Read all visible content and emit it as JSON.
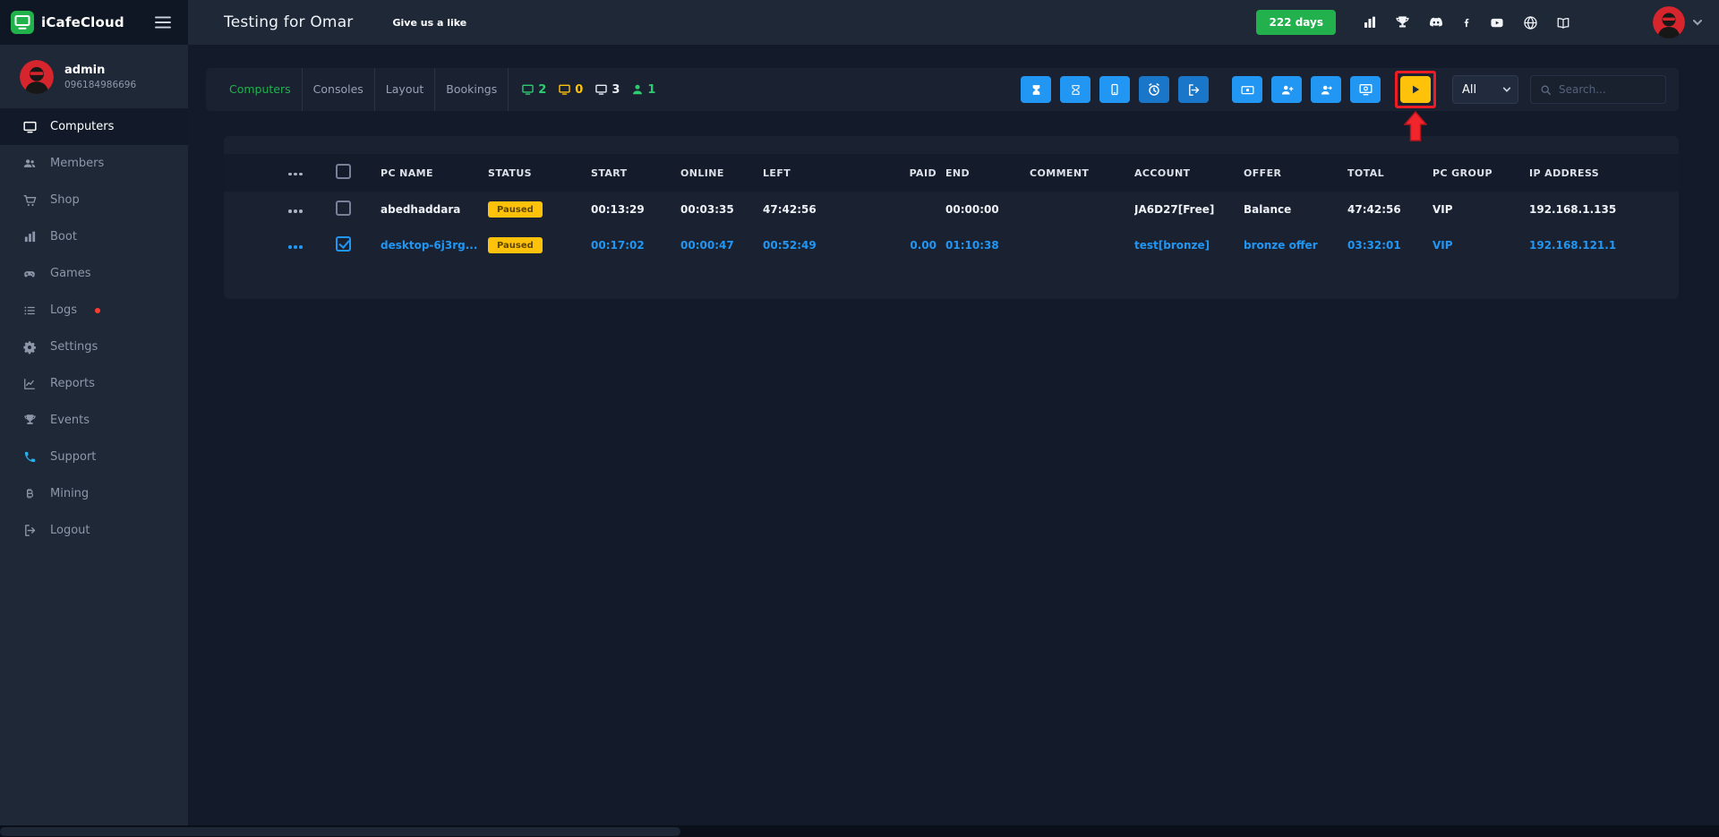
{
  "colors": {
    "accent_green": "#23b14d",
    "accent_blue": "#2196f3",
    "accent_yellow": "#ffc20a",
    "annotation_red": "#ee1c25"
  },
  "topbar": {
    "brand": "iCafeCloud",
    "title": "Testing for Omar",
    "like_link": "Give us a like",
    "days_badge": "222 days"
  },
  "user": {
    "name": "admin",
    "phone": "096184986696"
  },
  "sidebar": {
    "items": [
      {
        "label": "Computers",
        "active": true
      },
      {
        "label": "Members"
      },
      {
        "label": "Shop"
      },
      {
        "label": "Boot"
      },
      {
        "label": "Games"
      },
      {
        "label": "Logs",
        "has_alert_dot": true
      },
      {
        "label": "Settings"
      },
      {
        "label": "Reports"
      },
      {
        "label": "Events"
      },
      {
        "label": "Support",
        "icon_color": "#2badea"
      },
      {
        "label": "Mining"
      },
      {
        "label": "Logout"
      }
    ]
  },
  "toolbar": {
    "tabs": [
      {
        "label": "Computers",
        "active": true
      },
      {
        "label": "Consoles",
        "active": false
      },
      {
        "label": "Layout",
        "active": false
      },
      {
        "label": "Bookings",
        "active": false
      }
    ],
    "counters": [
      {
        "value": "2",
        "color": "#2ecc71"
      },
      {
        "value": "0",
        "color": "#ffc20a"
      },
      {
        "value": "3",
        "color": "#e9edf3"
      },
      {
        "value": "1",
        "color": "#2ecc71"
      }
    ],
    "filter_selected": "All",
    "search_placeholder": "Search..."
  },
  "table": {
    "headers": [
      "PC NAME",
      "STATUS",
      "START",
      "ONLINE",
      "LEFT",
      "PAID",
      "END",
      "COMMENT",
      "ACCOUNT",
      "OFFER",
      "TOTAL",
      "PC GROUP",
      "IP ADDRESS"
    ],
    "rows": [
      {
        "pc_name": "abedhaddara",
        "status": "Paused",
        "start": "00:13:29",
        "online": "00:03:35",
        "left": "47:42:56",
        "paid": "",
        "end": "00:00:00",
        "comment": "",
        "account": "JA6D27[Free]",
        "offer": "Balance",
        "total": "47:42:56",
        "pc_group": "VIP",
        "ip_address": "192.168.1.135",
        "checked": false,
        "selected": false
      },
      {
        "pc_name": "desktop-6j3rg...",
        "status": "Paused",
        "start": "00:17:02",
        "online": "00:00:47",
        "left": "00:52:49",
        "paid": "0.00",
        "end": "01:10:38",
        "comment": "",
        "account": "test[bronze]",
        "offer": "bronze offer",
        "total": "03:32:01",
        "pc_group": "VIP",
        "ip_address": "192.168.121.1",
        "checked": true,
        "selected": true
      }
    ]
  }
}
